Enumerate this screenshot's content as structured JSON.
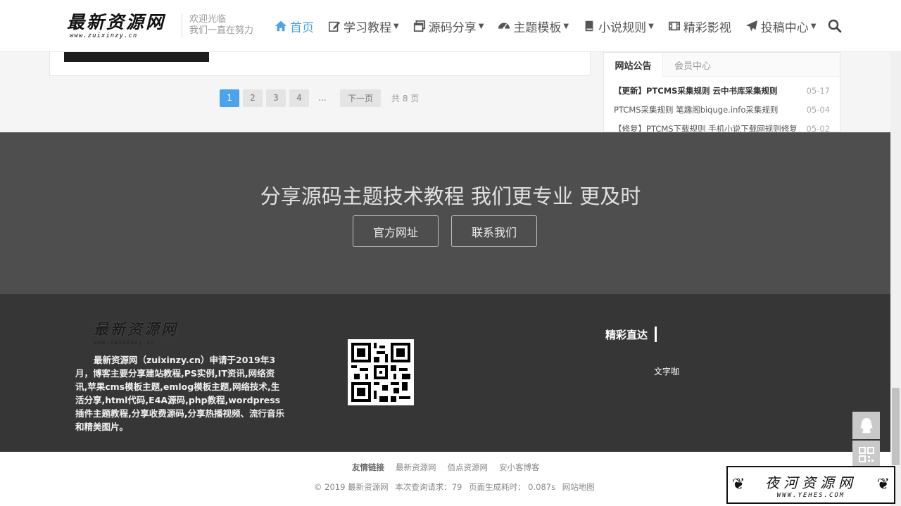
{
  "header": {
    "logo_main": "最新资源网",
    "logo_sub": "www.zuixinzy.cn",
    "slogan_line1": "欢迎光临",
    "slogan_line2": "我们一直在努力",
    "nav": [
      {
        "label": "首页",
        "icon": "home-icon",
        "dropdown": false,
        "active": true
      },
      {
        "label": "学习教程",
        "icon": "edit-icon",
        "dropdown": true,
        "active": false
      },
      {
        "label": "源码分享",
        "icon": "window-icon",
        "dropdown": true,
        "active": false
      },
      {
        "label": "主题模板",
        "icon": "dashboard-icon",
        "dropdown": true,
        "active": false
      },
      {
        "label": "小说规则",
        "icon": "book-icon",
        "dropdown": true,
        "active": false
      },
      {
        "label": "精彩影视",
        "icon": "film-icon",
        "dropdown": false,
        "active": false
      },
      {
        "label": "投稿中心",
        "icon": "send-icon",
        "dropdown": true,
        "active": false
      }
    ],
    "accent": "#4aa3ec"
  },
  "pagination": {
    "pages": [
      "1",
      "2",
      "3",
      "4"
    ],
    "current": "1",
    "ellipsis": "...",
    "next": "下一页",
    "total": "共 8 页"
  },
  "notice": {
    "tabs": [
      "网站公告",
      "会员中心"
    ],
    "items": [
      {
        "title": "【更新】PTCMS采集规则 云中书库采集规则",
        "date": "05-17"
      },
      {
        "title": "PTCMS采集规则 笔趣阁biquge.info采集规则",
        "date": "05-04"
      },
      {
        "title": "【修复】PTCMS下载规则 手机小说下载网规则修复...",
        "date": "05-02"
      }
    ]
  },
  "cta": {
    "title": "分享源码主题技术教程 我们更专业 更及时",
    "btn_official": "官方网址",
    "btn_contact": "联系我们"
  },
  "footer": {
    "logo_main": "最新资源网",
    "logo_sub": "www.zuixinzy.cn",
    "description": "最新资源网（zuixinzy.cn）申请于2019年3月，博客主要分享建站教程,PS实例,IT资讯,网络资讯,苹果cms模板主题,emlog模板主题,网络技术,生活分享,html代码,E4A源码,php教程,wordpress插件主题教程,分享收费源码,分享热播视频、流行音乐和精美图片。",
    "section_title": "精彩直达",
    "section_link": "文字咖"
  },
  "bottom": {
    "links_label": "友情链接",
    "links": [
      "最新资源网",
      "佰点资源网",
      "安小客博客"
    ],
    "copyright": "© 2019 最新资源网",
    "queries": "本次查询请求：79",
    "gen_time": "页面生成耗时： 0.087s",
    "sitemap": "网站地图"
  },
  "watermark": {
    "main": "夜河资源网",
    "sub": "WWW.YEHES.COM"
  }
}
